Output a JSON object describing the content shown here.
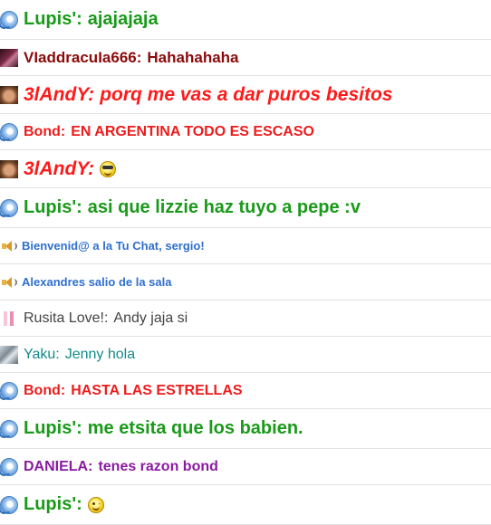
{
  "messages": [
    {
      "name": "Lupis':",
      "text": "ajajajaja",
      "avatar_icon": "blue-orb-icon"
    },
    {
      "name": "VIaddracuIa666:",
      "text": "Hahahahaha",
      "avatar_icon": "dark-photo-avatar"
    },
    {
      "name": "3lAndY:",
      "text": "porq me vas a dar puros besitos",
      "avatar_icon": "face-photo-avatar"
    },
    {
      "name": "Bond:",
      "text": "EN ARGENTINA TODO ES ESCASO",
      "avatar_icon": "blue-orb-icon"
    },
    {
      "name": "3lAndY:",
      "text": "",
      "avatar_icon": "face-photo-avatar",
      "emoji": "cool-smiley-icon"
    },
    {
      "name": "Lupis':",
      "text": "asi que lizzie haz tuyo a pepe :v",
      "avatar_icon": "blue-orb-icon"
    },
    {
      "name": "",
      "text": "Bienvenid@ a la Tu Chat, sergio!",
      "avatar_icon": "speaker-icon"
    },
    {
      "name": "",
      "text": "Alexandres salio de la sala",
      "avatar_icon": "speaker-icon"
    },
    {
      "name": "Rusita Love!:",
      "text": "Andy jaja si",
      "avatar_icon": "pink-avatar"
    },
    {
      "name": "Yaku:",
      "text": "Jenny hola",
      "avatar_icon": "gray-avatar"
    },
    {
      "name": "Bond:",
      "text": "HASTA LAS ESTRELLAS",
      "avatar_icon": "blue-orb-icon"
    },
    {
      "name": "Lupis':",
      "text": "me etsita que los babien.",
      "avatar_icon": "blue-orb-icon"
    },
    {
      "name": "DANIELA:",
      "text": "tenes razon bond",
      "avatar_icon": "blue-orb-icon"
    },
    {
      "name": "Lupis':",
      "text": "",
      "avatar_icon": "blue-orb-icon",
      "emoji": "wink-smiley-icon"
    }
  ],
  "colors": {
    "lupis": "#1a9a1a",
    "vladdracula": "#8b0a0a",
    "andy": "#ff1a1a",
    "bond": "#ee1c1c",
    "system": "#2f6fcf",
    "rusita": "#444444",
    "yaku": "#138a8a",
    "daniela": "#8a1aa0",
    "row_divider": "#e2e2e2"
  }
}
